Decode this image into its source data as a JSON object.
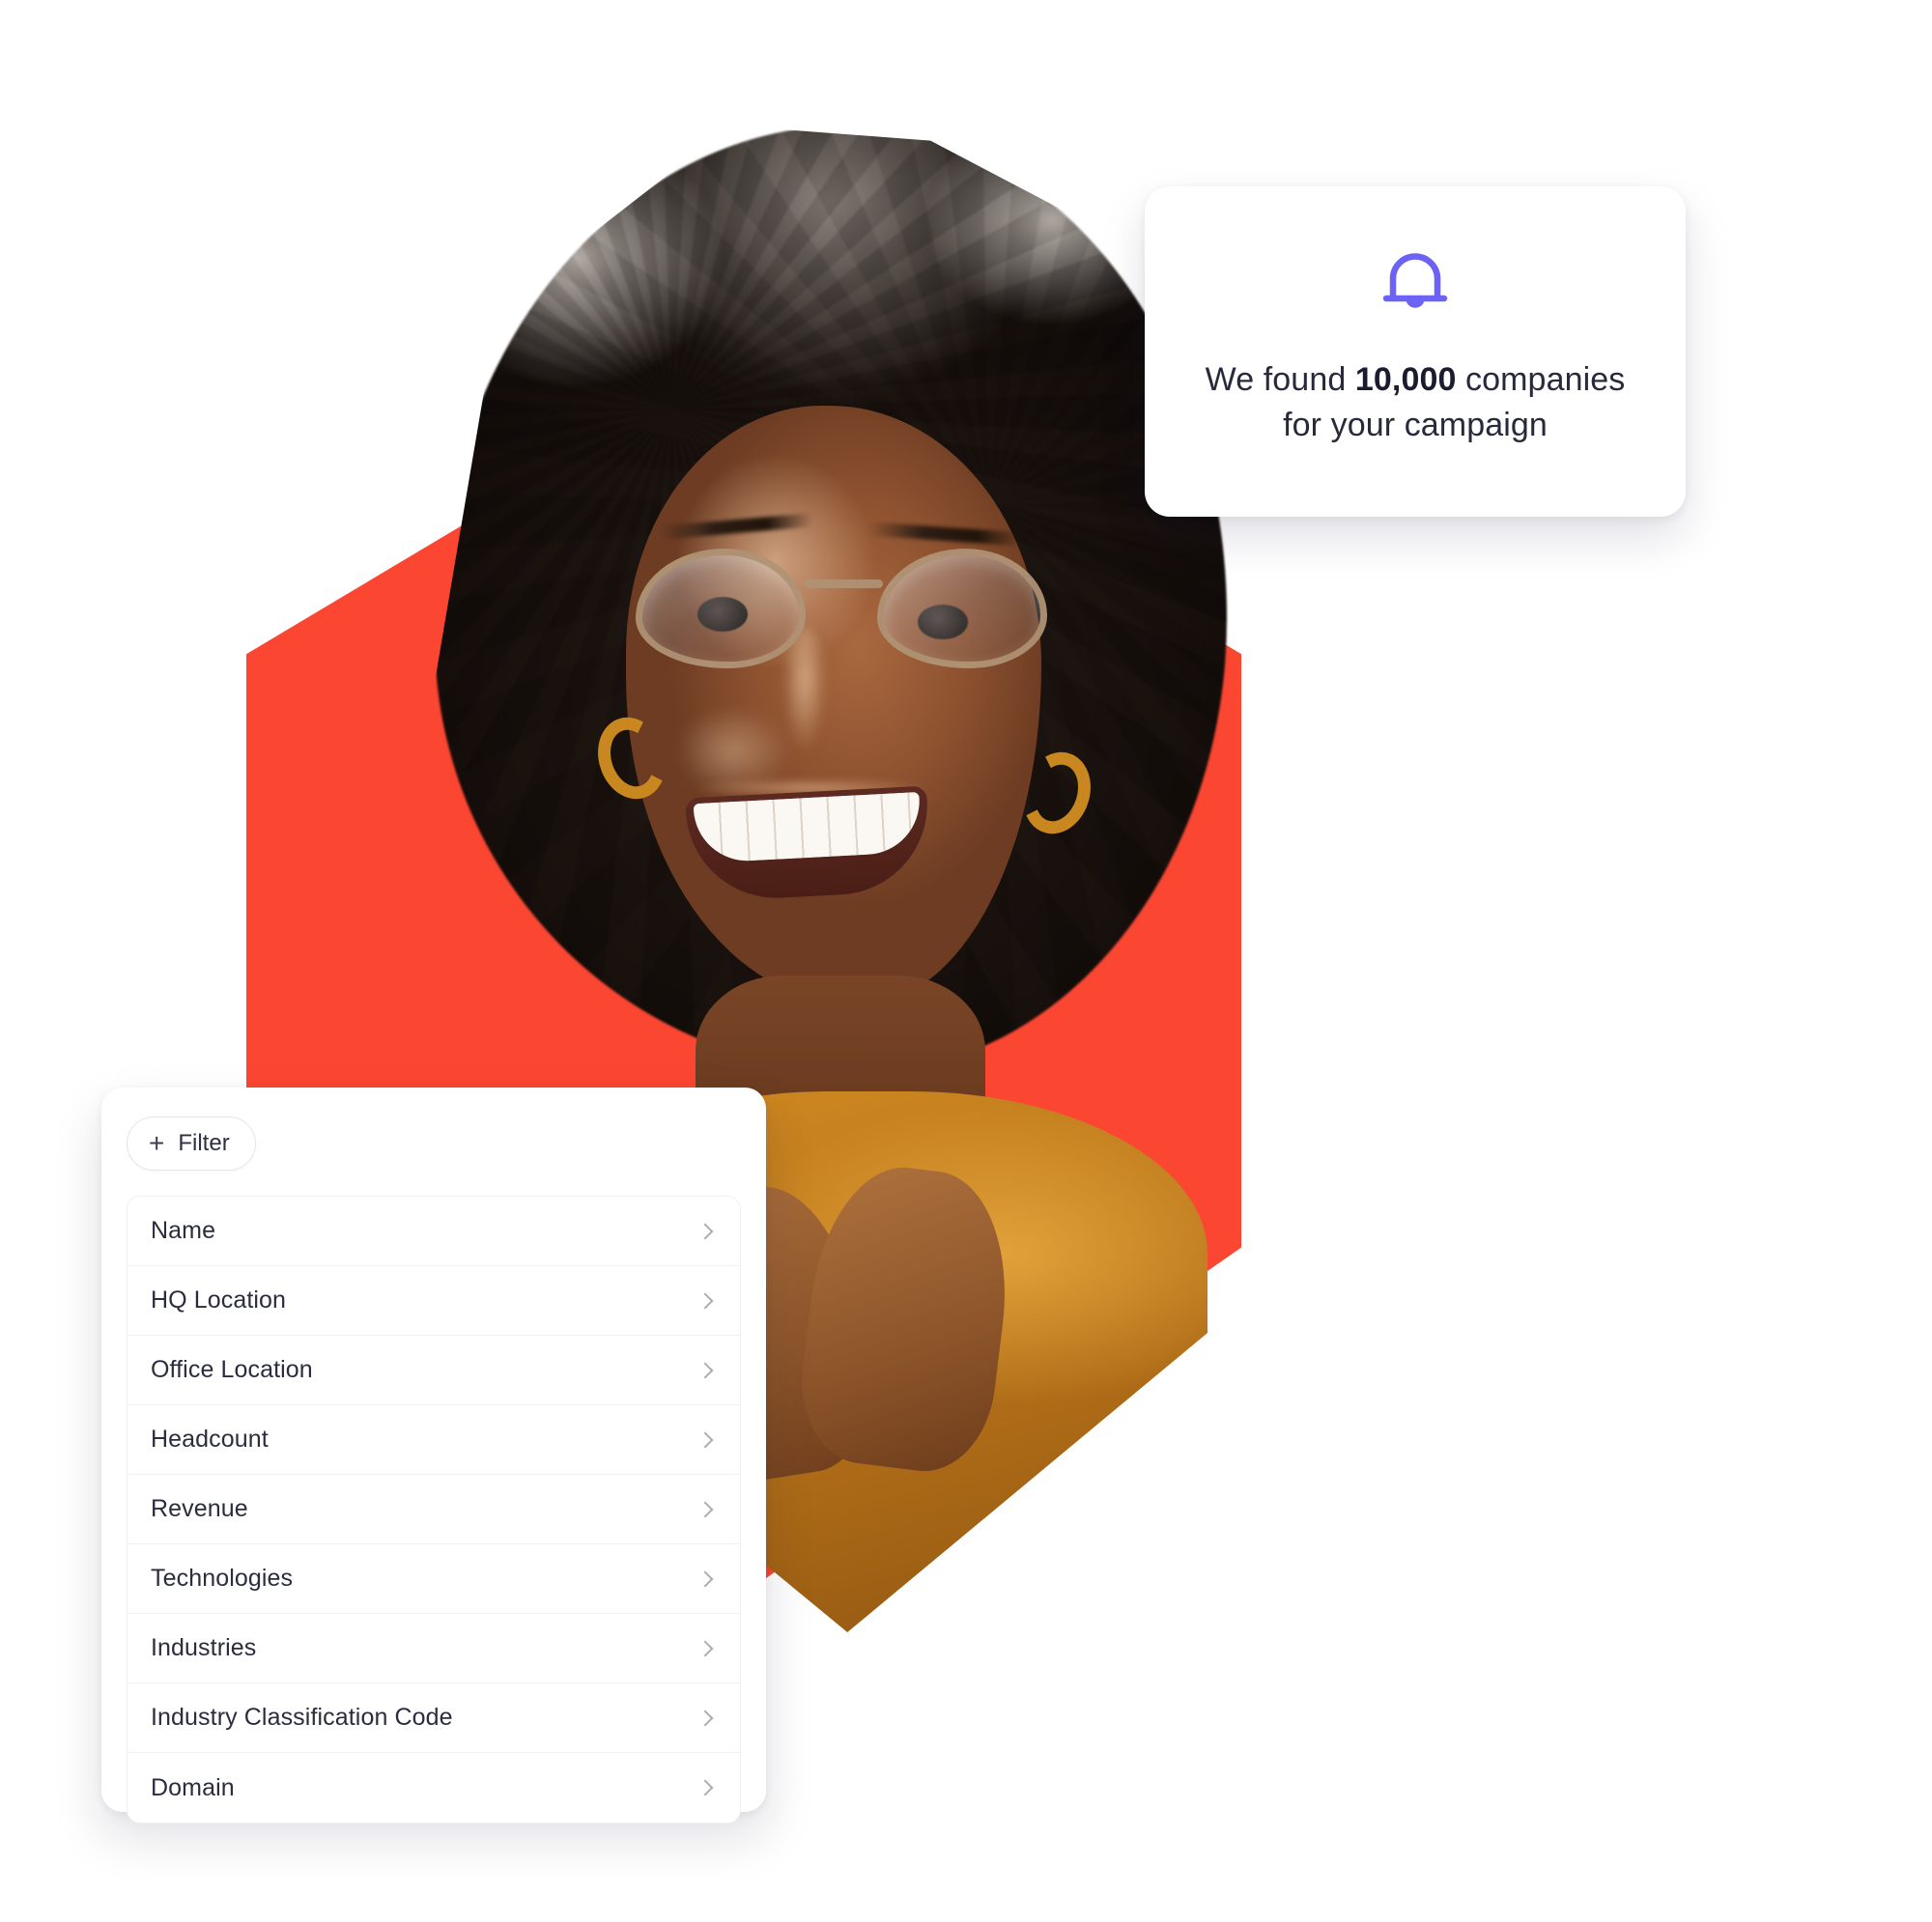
{
  "theme": {
    "accent_purple": "#6C63F5",
    "accent_red": "#FB4632",
    "card_bg": "#FFFFFF",
    "text_dark": "#282A3C",
    "chevron_gray": "#A9ACBA"
  },
  "notification": {
    "icon": "bell-icon",
    "text_before": "We found ",
    "count": "10,000",
    "text_after": " companies for your campaign",
    "full_text": "We found 10,000 companies for your campaign"
  },
  "filter_panel": {
    "add_filter_button": {
      "icon": "plus-icon",
      "plus": "+",
      "label": "Filter"
    },
    "items": [
      {
        "label": "Name",
        "icon": "chevron-right-icon"
      },
      {
        "label": "HQ Location",
        "icon": "chevron-right-icon"
      },
      {
        "label": "Office Location",
        "icon": "chevron-right-icon"
      },
      {
        "label": "Headcount",
        "icon": "chevron-right-icon"
      },
      {
        "label": "Revenue",
        "icon": "chevron-right-icon"
      },
      {
        "label": "Technologies",
        "icon": "chevron-right-icon"
      },
      {
        "label": "Industries",
        "icon": "chevron-right-icon"
      },
      {
        "label": "Industry Classification Code",
        "icon": "chevron-right-icon"
      },
      {
        "label": "Domain",
        "icon": "chevron-right-icon"
      }
    ]
  },
  "hero_image": {
    "alt": "Smiling woman with glasses and natural afro hair, hands under chin, wearing a mustard top, on a red hexagon backdrop",
    "shape": "hexagon",
    "backdrop_color": "#FB4632"
  }
}
